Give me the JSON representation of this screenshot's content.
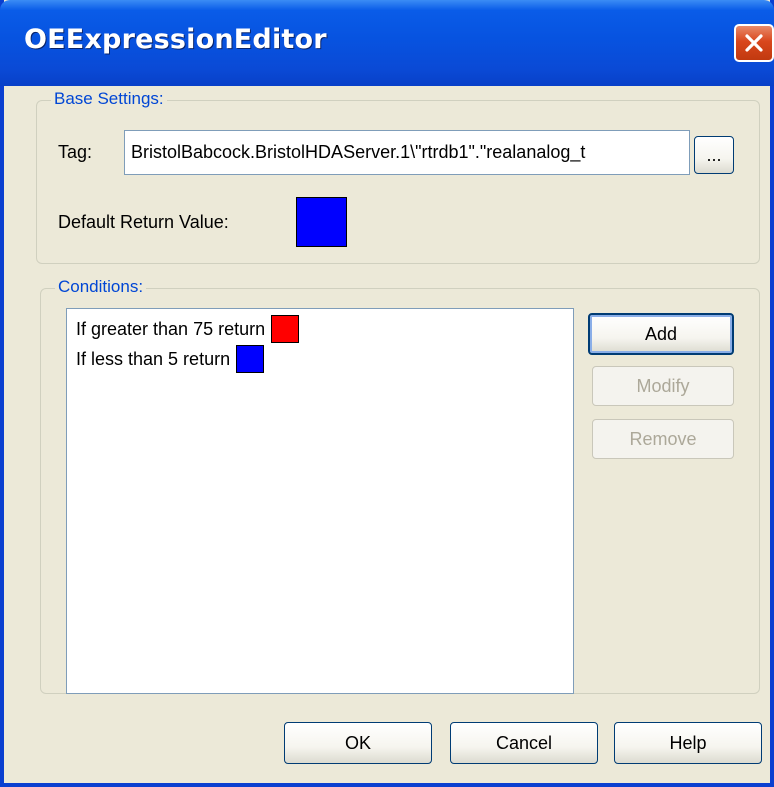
{
  "window": {
    "title": "OEExpressionEditor"
  },
  "base_settings": {
    "legend": "Base Settings:",
    "tag_label": "Tag:",
    "tag_value": "BristolBabcock.BristolHDAServer.1\\\"rtrdb1\".\"realanalog_t",
    "browse_label": "...",
    "default_return_label": "Default Return Value:",
    "default_return_color": "#0000ff"
  },
  "conditions": {
    "legend": "Conditions:",
    "items": [
      {
        "text": "If greater than 75 return",
        "color": "#ff0000"
      },
      {
        "text": "If less than 5 return",
        "color": "#0000ff"
      }
    ],
    "add_label": "Add",
    "modify_label": "Modify",
    "remove_label": "Remove"
  },
  "footer": {
    "ok_label": "OK",
    "cancel_label": "Cancel",
    "help_label": "Help"
  }
}
